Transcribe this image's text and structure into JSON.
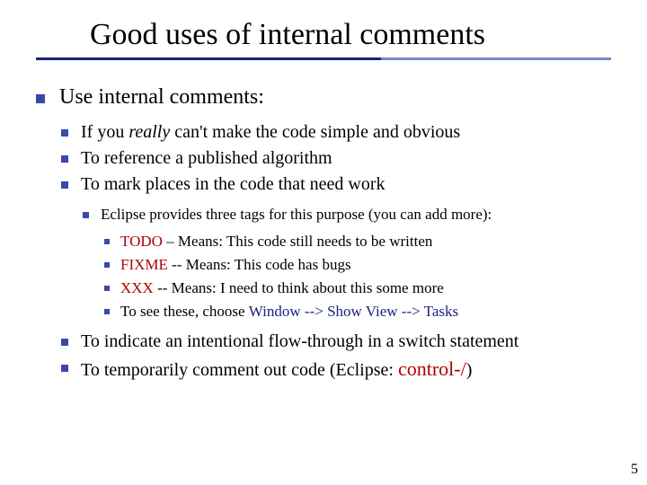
{
  "title": "Good uses of internal comments",
  "b1": "Use internal comments:",
  "b2a_pre": "If you ",
  "b2a_em": "really",
  "b2a_post": " can't make the code simple and obvious",
  "b2b": "To reference a published algorithm",
  "b2c": "To mark places in the code that need work",
  "b3": "Eclipse provides three tags for this purpose (you can add more):",
  "b4a_tag": "TODO",
  "b4a_rest": " – Means: This code still needs to be written",
  "b4b_tag": "FIXME",
  "b4b_rest": " -- Means: This code has bugs",
  "b4c_tag": "XXX",
  "b4c_rest": " -- Means: I need to think about this some more",
  "b4d_pre": "To see these, choose ",
  "b4d_menu": "Window --> Show View --> Tasks",
  "b2d": "To indicate an intentional flow-through in a switch statement",
  "b2e_pre": "To temporarily comment out code (Eclipse: ",
  "b2e_kb": "control-/",
  "b2e_post": ")",
  "page": "5"
}
